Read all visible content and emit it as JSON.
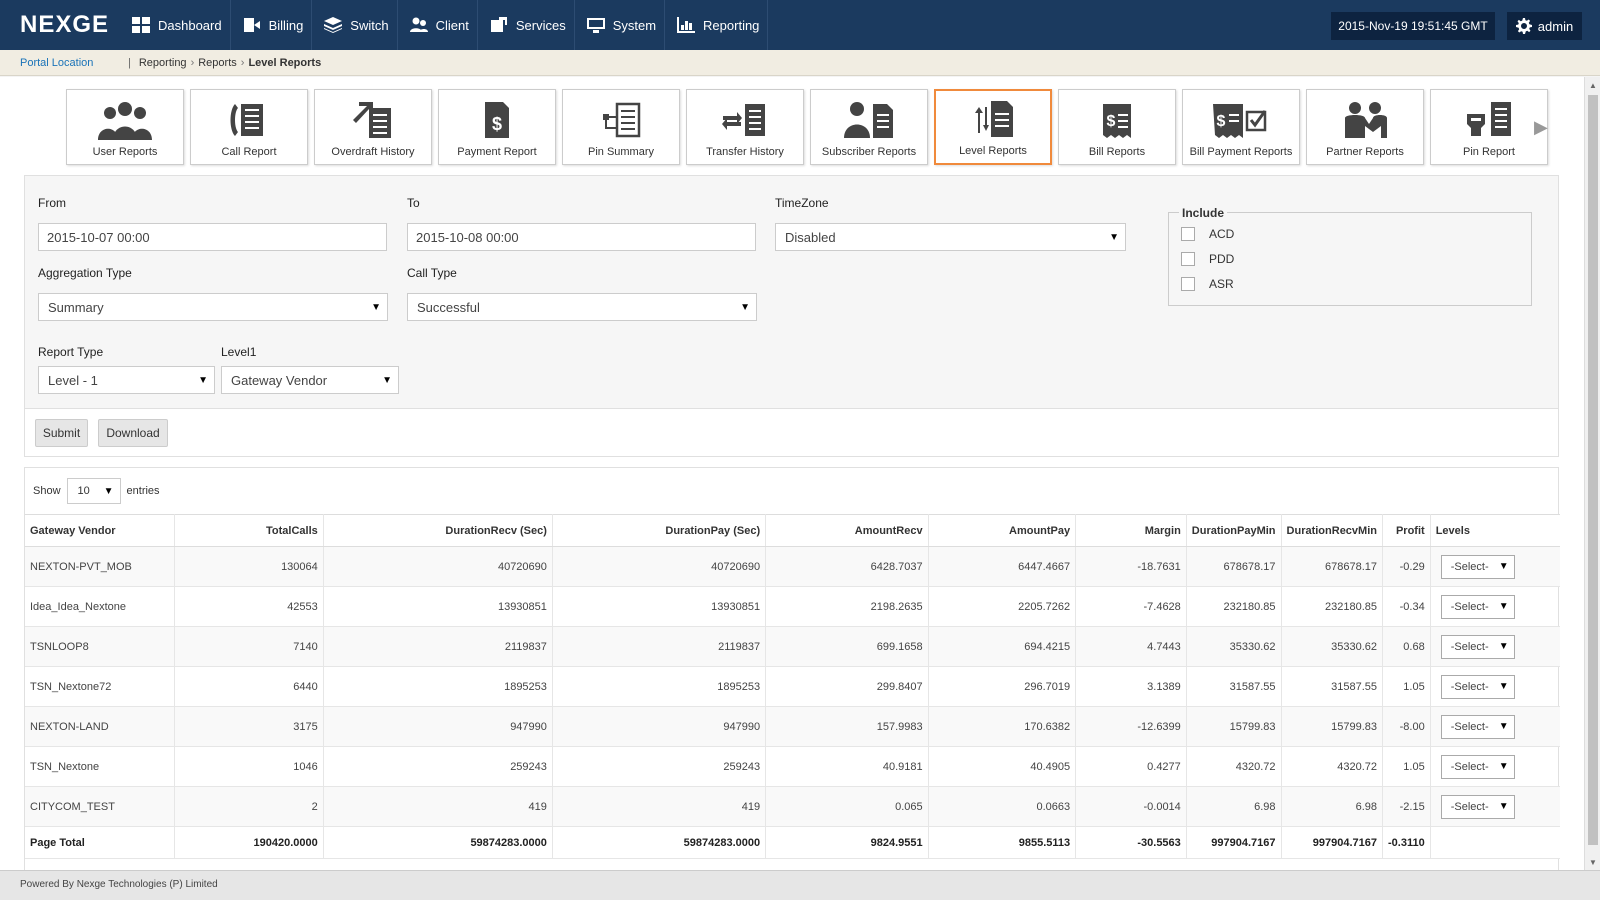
{
  "app": {
    "logo": "NEXGE"
  },
  "nav": [
    {
      "label": "Dashboard",
      "icon": "dashboard-icon"
    },
    {
      "label": "Billing",
      "icon": "billing-icon"
    },
    {
      "label": "Switch",
      "icon": "switch-icon"
    },
    {
      "label": "Client",
      "icon": "client-icon"
    },
    {
      "label": "Services",
      "icon": "services-icon"
    },
    {
      "label": "System",
      "icon": "system-icon"
    },
    {
      "label": "Reporting",
      "icon": "reporting-icon"
    }
  ],
  "header": {
    "datetime": "2015-Nov-19 19:51:45 GMT",
    "user": "admin"
  },
  "breadcrumb": {
    "portal": "Portal Location",
    "separator": "|",
    "items": [
      "Reporting",
      "Reports",
      "Level Reports"
    ]
  },
  "tiles": [
    {
      "label": "User Reports",
      "icon": "users-icon"
    },
    {
      "label": "Call Report",
      "icon": "call-report-icon"
    },
    {
      "label": "Overdraft History",
      "icon": "overdraft-icon"
    },
    {
      "label": "Payment Report",
      "icon": "payment-icon"
    },
    {
      "label": "Pin Summary",
      "icon": "pin-summary-icon"
    },
    {
      "label": "Transfer History",
      "icon": "transfer-icon"
    },
    {
      "label": "Subscriber Reports",
      "icon": "subscriber-icon"
    },
    {
      "label": "Level Reports",
      "icon": "level-icon"
    },
    {
      "label": "Bill Reports",
      "icon": "bill-icon"
    },
    {
      "label": "Bill Payment Reports",
      "icon": "bill-payment-icon"
    },
    {
      "label": "Partner Reports",
      "icon": "partner-icon"
    },
    {
      "label": "Pin Report",
      "icon": "pin-report-icon"
    }
  ],
  "filter": {
    "from_label": "From",
    "from_value": "2015-10-07 00:00",
    "to_label": "To",
    "to_value": "2015-10-08 00:00",
    "timezone_label": "TimeZone",
    "timezone_value": "Disabled",
    "aggregation_label": "Aggregation Type",
    "aggregation_value": "Summary",
    "calltype_label": "Call Type",
    "calltype_value": "Successful",
    "reporttype_label": "Report Type",
    "reporttype_value": "Level - 1",
    "level1_label": "Level1",
    "level1_value": "Gateway Vendor",
    "include_label": "Include",
    "include_options": [
      "ACD",
      "PDD",
      "ASR"
    ],
    "submit_label": "Submit",
    "download_label": "Download"
  },
  "table": {
    "show_label": "Show",
    "entries_value": "10",
    "entries_label": "entries",
    "columns": [
      "Gateway Vendor",
      "TotalCalls",
      "DurationRecv (Sec)",
      "DurationPay (Sec)",
      "AmountRecv",
      "AmountPay",
      "Margin",
      "DurationPayMin",
      "DurationRecvMin",
      "Profit",
      "Levels"
    ],
    "rows": [
      [
        "NEXTON-PVT_MOB",
        "130064",
        "40720690",
        "40720690",
        "6428.7037",
        "6447.4667",
        "-18.7631",
        "678678.17",
        "678678.17",
        "-0.29"
      ],
      [
        "Idea_Idea_Nextone",
        "42553",
        "13930851",
        "13930851",
        "2198.2635",
        "2205.7262",
        "-7.4628",
        "232180.85",
        "232180.85",
        "-0.34"
      ],
      [
        "TSNLOOP8",
        "7140",
        "2119837",
        "2119837",
        "699.1658",
        "694.4215",
        "4.7443",
        "35330.62",
        "35330.62",
        "0.68"
      ],
      [
        "TSN_Nextone72",
        "6440",
        "1895253",
        "1895253",
        "299.8407",
        "296.7019",
        "3.1389",
        "31587.55",
        "31587.55",
        "1.05"
      ],
      [
        "NEXTON-LAND",
        "3175",
        "947990",
        "947990",
        "157.9983",
        "170.6382",
        "-12.6399",
        "15799.83",
        "15799.83",
        "-8.00"
      ],
      [
        "TSN_Nextone",
        "1046",
        "259243",
        "259243",
        "40.9181",
        "40.4905",
        "0.4277",
        "4320.72",
        "4320.72",
        "1.05"
      ],
      [
        "CITYCOM_TEST",
        "2",
        "419",
        "419",
        "0.065",
        "0.0663",
        "-0.0014",
        "6.98",
        "6.98",
        "-2.15"
      ]
    ],
    "level_select": "-Select-",
    "total": [
      "Page Total",
      "190420.0000",
      "59874283.0000",
      "59874283.0000",
      "9824.9551",
      "9855.5113",
      "-30.5563",
      "997904.7167",
      "997904.7167",
      "-0.3110"
    ]
  },
  "footer": {
    "text": "Powered By Nexge Technologies (P) Limited"
  }
}
